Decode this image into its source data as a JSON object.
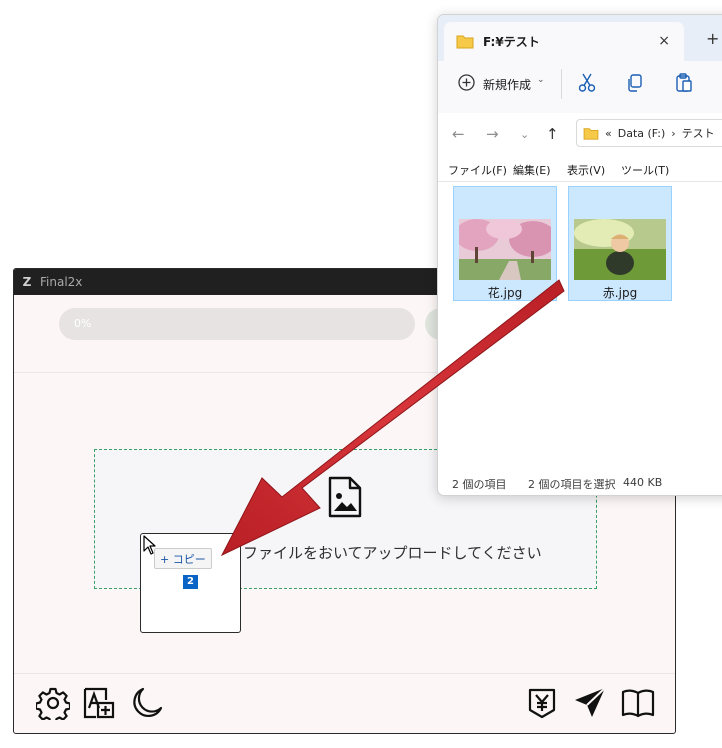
{
  "final2x": {
    "logo": "Z",
    "title": "Final2x",
    "progress": {
      "label": "0%",
      "value": 0
    },
    "drop_zone_text": "ファイルをおいてアップロードしてください",
    "toolbar_icons": [
      "gear-icon",
      "translate-icon",
      "moon-icon",
      "yen-download-icon",
      "send-icon",
      "book-icon"
    ]
  },
  "explorer": {
    "tab_title": "F:¥テスト",
    "tab_close": "×",
    "new_tab": "+",
    "new_button_label": "新規作成",
    "new_button_chevron": "⌄",
    "address": {
      "chevrons": "«",
      "drive": "Data (F:)",
      "separator": "›",
      "folder": "テスト"
    },
    "menu": [
      {
        "label": "ファイル(F)"
      },
      {
        "label": "編集(E)"
      },
      {
        "label": "表示(V)"
      },
      {
        "label": "ツール(T)"
      }
    ],
    "files": [
      {
        "name": "花.jpg",
        "selected": true
      },
      {
        "name": "赤.jpg",
        "selected": true
      }
    ],
    "status": {
      "count": "2 個の項目",
      "selected": "2 個の項目を選択",
      "size": "440 KB"
    }
  },
  "drag_ghost": {
    "action": "+ コピー",
    "count": "2"
  },
  "colors": {
    "arrow": "#c8262b",
    "selection": "#cce8ff",
    "dropzone_border": "#38a169"
  }
}
